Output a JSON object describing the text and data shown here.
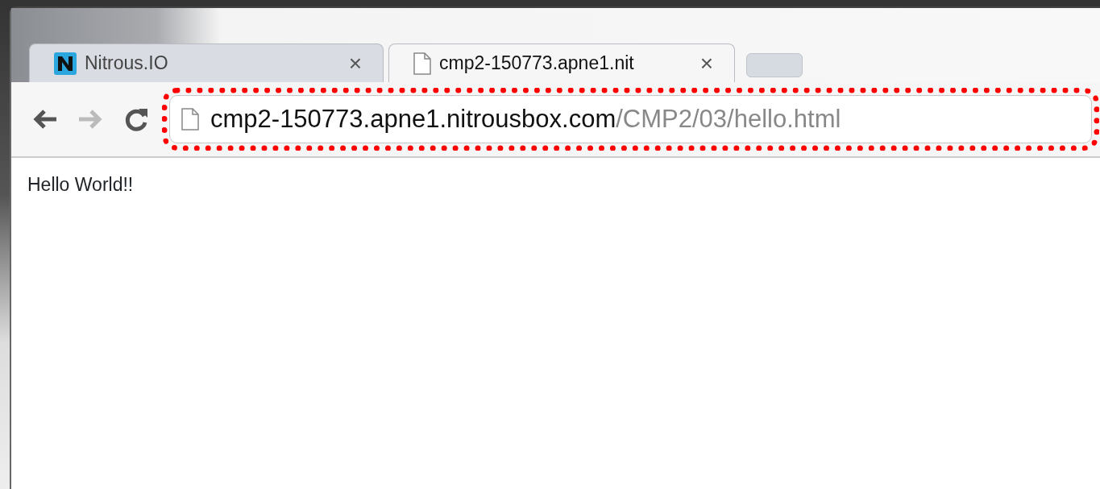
{
  "tabs": [
    {
      "title": "Nitrous.IO",
      "kind": "logo",
      "close": "×",
      "selected": false
    },
    {
      "title": "cmp2-150773.apne1.nit",
      "kind": "page",
      "close": "×",
      "selected": true
    }
  ],
  "toolbar": {
    "back_disabled": false,
    "forward_disabled": true
  },
  "address_bar": {
    "host": "cmp2-150773.apne1.nitrousbox.com",
    "path": "/CMP2/03/hello.html",
    "highlighted": true
  },
  "page": {
    "text": "Hello World!!"
  }
}
